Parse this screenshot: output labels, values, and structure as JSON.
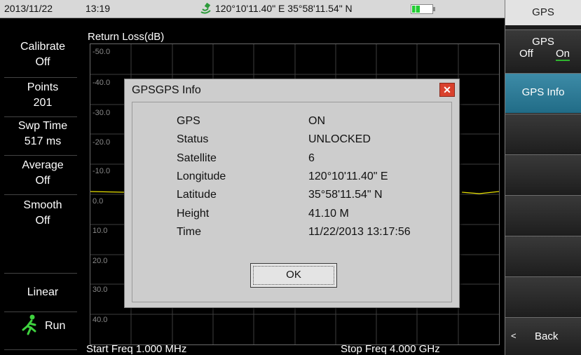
{
  "status_bar": {
    "date": "2013/11/22",
    "time": "13:19",
    "gps_coords": "120°10'11.40\" E 35°58'11.54\" N",
    "battery_level": 0.4
  },
  "left_panel": {
    "items": [
      {
        "label": "Calibrate",
        "value": "Off"
      },
      {
        "label": "Points",
        "value": "201"
      },
      {
        "label": "Swp Time",
        "value": "517 ms"
      },
      {
        "label": "Average",
        "value": "Off"
      },
      {
        "label": "Smooth",
        "value": "Off"
      }
    ],
    "linear_label": "Linear",
    "run_label": "Run"
  },
  "graph": {
    "title": "Return Loss(dB)",
    "y_ticks": [
      "-50.0",
      "-40.0",
      "-30.0",
      "-20.0",
      "-10.0",
      "0.0",
      "10.0",
      "20.0",
      "30.0",
      "40.0"
    ],
    "start_freq": "Start Freq 1.000 MHz",
    "stop_freq": "Stop Freq 4.000 GHz"
  },
  "right_panel": {
    "header": "GPS",
    "gps_toggle": {
      "label": "GPS",
      "off": "Off",
      "on": "On",
      "selected": "On"
    },
    "gps_info": "GPS Info",
    "back_arrow": "<",
    "back": "Back"
  },
  "dialog": {
    "title": "GPSGPS Info",
    "close_symbol": "✕",
    "rows": [
      {
        "label": "GPS",
        "value": "ON"
      },
      {
        "label": "Status",
        "value": "UNLOCKED"
      },
      {
        "label": "Satellite",
        "value": "6"
      },
      {
        "label": "Longitude",
        "value": "120°10'11.40\" E"
      },
      {
        "label": "Latitude",
        "value": "35°58'11.54\" N"
      },
      {
        "label": "Height",
        "value": "41.10 M"
      },
      {
        "label": "Time",
        "value": "11/22/2013 13:17:56"
      }
    ],
    "ok": "OK"
  },
  "colors": {
    "accent": "#2e7a96",
    "trace": "#e8e000",
    "toggle_underline": "#2fb52f",
    "battery": "#22cc33",
    "close": "#d9412d"
  },
  "icons": {
    "satellite": "satellite-icon",
    "battery": "battery-icon",
    "run": "running-man-icon",
    "close": "close-icon"
  }
}
